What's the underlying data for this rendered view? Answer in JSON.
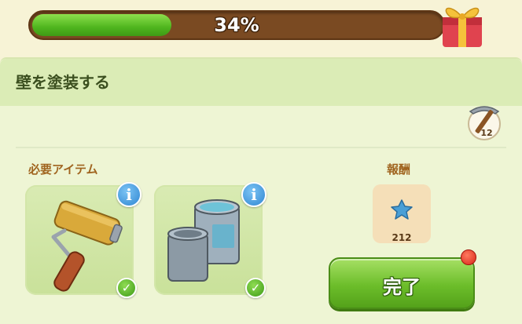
{
  "progress": {
    "percent": 0.34,
    "label": "34%"
  },
  "task": {
    "title": "壁を塗装する"
  },
  "tool": {
    "icon": "pickaxe-icon",
    "count": "12"
  },
  "requirements": {
    "label": "必要アイテム",
    "items": [
      {
        "icon": "paint-roller-icon",
        "info_label": "i",
        "status": "checked"
      },
      {
        "icon": "paint-cans-icon",
        "info_label": "i",
        "status": "checked"
      }
    ]
  },
  "reward": {
    "label": "報酬",
    "icon": "blue-star-icon",
    "value": "212"
  },
  "complete_button": {
    "label": "完了"
  },
  "colors": {
    "accent_green": "#6cbd2a",
    "progress_green": "#4fb51e",
    "info_blue": "#2f86d2",
    "notification_red": "#d9261a"
  }
}
